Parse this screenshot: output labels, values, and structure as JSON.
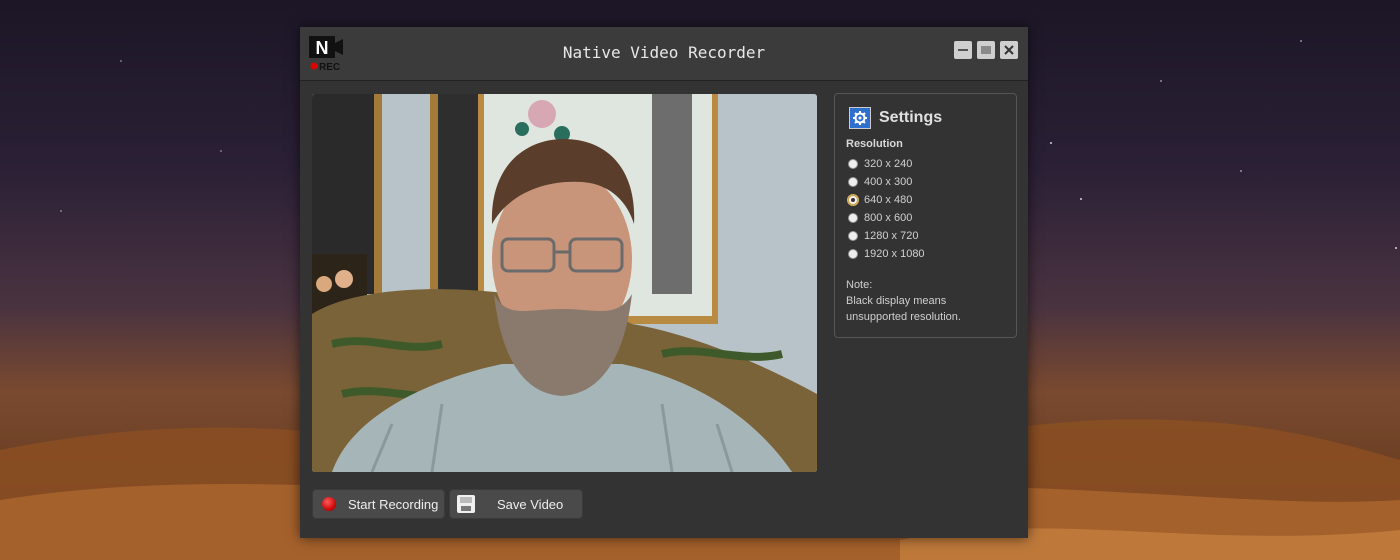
{
  "window": {
    "title": "Native Video Recorder",
    "logo_text": "N",
    "logo_rec": "REC"
  },
  "settings": {
    "title": "Settings",
    "resolution_label": "Resolution",
    "options": [
      {
        "label": "320 x 240",
        "selected": false
      },
      {
        "label": "400 x 300",
        "selected": false
      },
      {
        "label": "640 x 480",
        "selected": true
      },
      {
        "label": "800 x 600",
        "selected": false
      },
      {
        "label": "1280 x 720",
        "selected": false
      },
      {
        "label": "1920 x 1080",
        "selected": false
      }
    ],
    "note_label": "Note:",
    "note_line1": "Black display means",
    "note_line2": "unsupported resolution."
  },
  "buttons": {
    "start_recording": "Start Recording",
    "save_video": "Save Video"
  },
  "colors": {
    "window_bg": "#333333",
    "titlebar_bg": "#3b3b3b",
    "accent_record": "#d40000",
    "gear_blue": "#2f6fd0"
  },
  "icons": [
    "app-logo-icon",
    "minimize-icon",
    "maximize-icon",
    "close-icon",
    "gear-icon",
    "record-icon",
    "floppy-icon"
  ]
}
